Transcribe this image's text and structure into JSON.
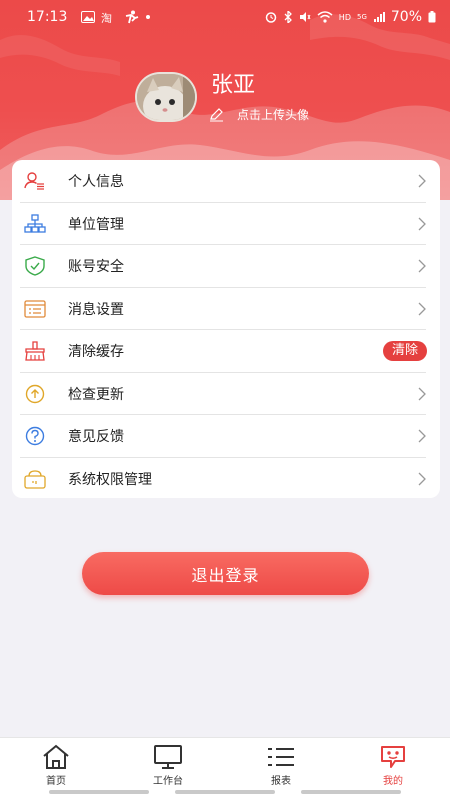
{
  "status_bar": {
    "time": "17:13",
    "battery": "70%",
    "network": "5G",
    "hd": "HD"
  },
  "profile": {
    "name": "张亚",
    "upload_hint": "点击上传头像"
  },
  "menu": [
    {
      "label": "个人信息",
      "icon": "person-info-icon",
      "color": "#e5403f"
    },
    {
      "label": "单位管理",
      "icon": "org-chart-icon",
      "color": "#3d7de0"
    },
    {
      "label": "账号安全",
      "icon": "shield-check-icon",
      "color": "#3aaa4a"
    },
    {
      "label": "消息设置",
      "icon": "message-list-icon",
      "color": "#e08a3a"
    },
    {
      "label": "清除缓存",
      "icon": "broom-icon",
      "color": "#e5403f",
      "badge": "清除"
    },
    {
      "label": "检查更新",
      "icon": "upload-circle-icon",
      "color": "#e0a72a"
    },
    {
      "label": "意见反馈",
      "icon": "question-circle-icon",
      "color": "#3d7de0"
    },
    {
      "label": "系统权限管理",
      "icon": "permission-icon",
      "color": "#e0a72a"
    }
  ],
  "logout_label": "退出登录",
  "tabs": [
    {
      "label": "首页",
      "icon": "home-icon"
    },
    {
      "label": "工作台",
      "icon": "monitor-icon"
    },
    {
      "label": "报表",
      "icon": "list-icon"
    },
    {
      "label": "我的",
      "icon": "mine-icon",
      "active": true
    }
  ],
  "colors": {
    "brand": "#e5403f",
    "header": "#ec4a49"
  }
}
